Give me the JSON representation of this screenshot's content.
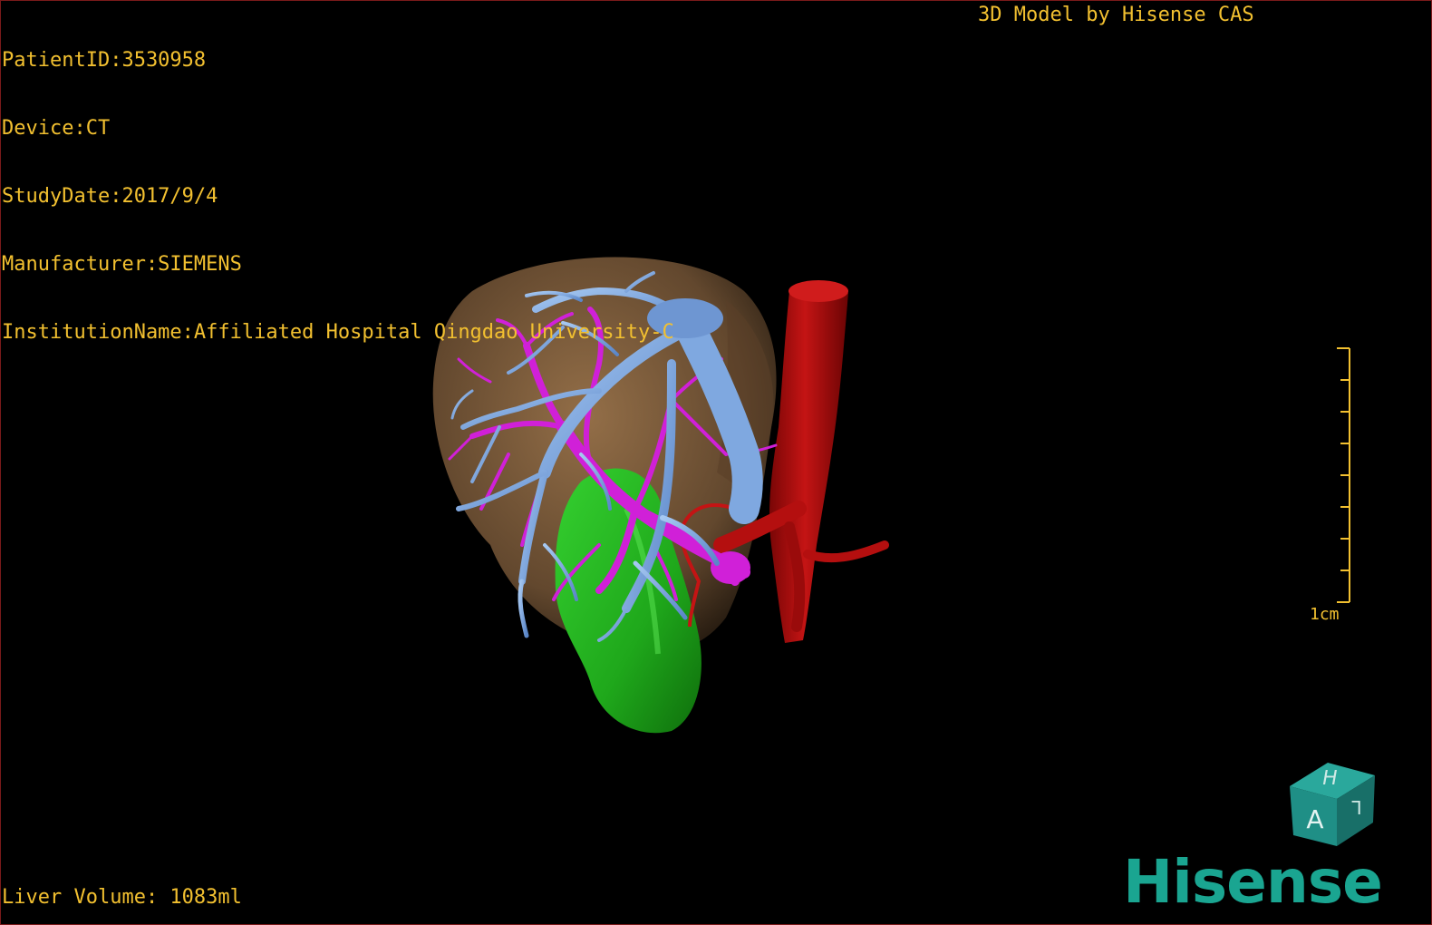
{
  "window": {
    "credit": "3D Model by Hisense CAS"
  },
  "dicom": {
    "lines": [
      "PatientID:3530958",
      "Device:CT",
      "StudyDate:2017/9/4",
      "Manufacturer:SIEMENS",
      "InstitutionName:Affiliated Hospital Qingdao University-C"
    ]
  },
  "measurement": {
    "liver_volume": "Liver Volume: 1083ml"
  },
  "scale": {
    "label": "1cm"
  },
  "orientation_cube": {
    "top_face": "H",
    "front_face": "A",
    "side_face": "L"
  },
  "brand": {
    "name": "Hisense"
  },
  "colors": {
    "overlay_text": "#f2c030",
    "liver": "#7a5a3a",
    "hepatic_vein": "#7fa8e0",
    "portal_vein": "#d020d8",
    "artery_ivc": "#b00d0d",
    "gallbladder": "#22b81e",
    "brand_teal": "#1aa591",
    "cube_teal": "#1f8f86"
  },
  "structures": [
    {
      "name": "liver",
      "icon": "liver-3d-model"
    },
    {
      "name": "hepatic-veins",
      "icon": "vessel-tree"
    },
    {
      "name": "portal-veins",
      "icon": "vessel-tree"
    },
    {
      "name": "inferior-vena-cava",
      "icon": "vessel"
    },
    {
      "name": "gallbladder",
      "icon": "organ"
    }
  ]
}
